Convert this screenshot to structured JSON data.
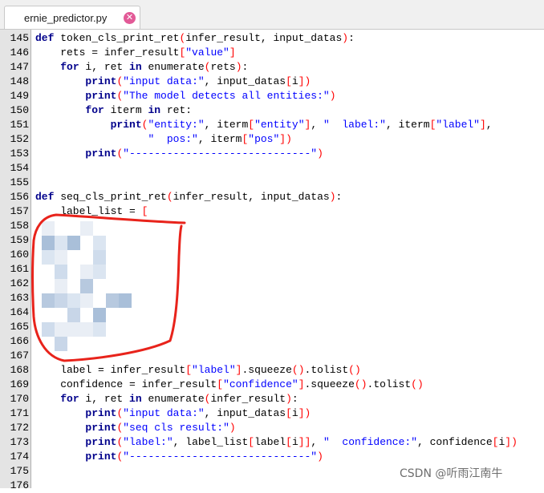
{
  "tab": {
    "filename": "ernie_predictor.py",
    "close_icon": "close-icon"
  },
  "line_numbers": [
    "145",
    "146",
    "147",
    "148",
    "149",
    "150",
    "151",
    "152",
    "153",
    "154",
    "155",
    "156",
    "157",
    "158",
    "159",
    "160",
    "161",
    "162",
    "163",
    "164",
    "165",
    "166",
    "167",
    "168",
    "169",
    "170",
    "171",
    "172",
    "173",
    "174",
    "175",
    "176"
  ],
  "code_lines": [
    "def token_cls_print_ret(infer_result, input_datas):",
    "    rets = infer_result[\"value\"]",
    "    for i, ret in enumerate(rets):",
    "        print(\"input data:\", input_datas[i])",
    "        print(\"The model detects all entities:\")",
    "        for iterm in ret:",
    "            print(\"entity:\", iterm[\"entity\"], \"  label:\", iterm[\"label\"],",
    "                  \"  pos:\", iterm[\"pos\"])",
    "        print(\"-----------------------------\")",
    "",
    "",
    "def seq_cls_print_ret(infer_result, input_datas):",
    "    label_list = [",
    "",
    "",
    "",
    "",
    "",
    "",
    "",
    "",
    "",
    "    ]",
    "    label = infer_result[\"label\"].squeeze().tolist()",
    "    confidence = infer_result[\"confidence\"].squeeze().tolist()",
    "    for i, ret in enumerate(infer_result):",
    "        print(\"input data:\", input_datas[i])",
    "        print(\"seq cls result:\")",
    "        print(\"label:\", label_list[label[i]], \"  confidence:\", confidence[i])",
    "        print(\"-----------------------------\")",
    "",
    ""
  ],
  "watermark": "CSDN @听雨江南牛",
  "colors": {
    "keyword": "#00008b",
    "string": "#0000ff",
    "bracket": "#ff0000",
    "annotation": "#e8231b"
  }
}
